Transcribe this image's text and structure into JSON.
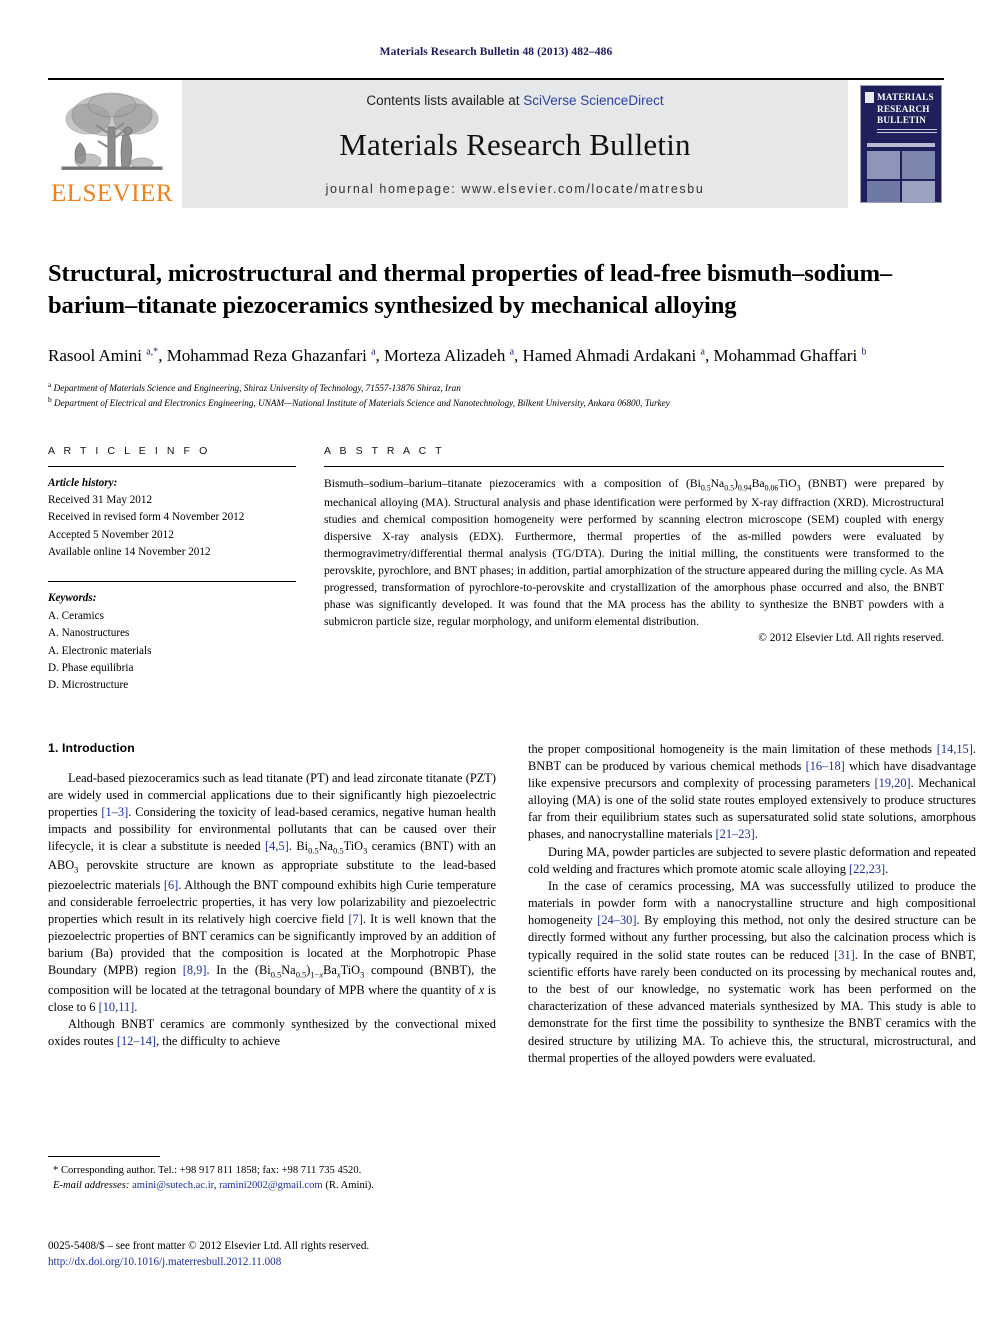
{
  "running_head": "Materials Research Bulletin 48 (2013) 482–486",
  "masthead": {
    "contents_prefix": "Contents lists available at ",
    "sciencedirect_link": "SciVerse ScienceDirect",
    "journal_title": "Materials Research Bulletin",
    "homepage": "journal homepage: www.elsevier.com/locate/matresbu",
    "publisher_wordmark": "ELSEVIER",
    "publisher_color": "#F08019",
    "link_color": "#2b42a8",
    "cover": {
      "line1": "MATERIALS",
      "line2": "RESEARCH",
      "line3": "BULLETIN",
      "background_color": "#1f1f5c"
    }
  },
  "article": {
    "title": "Structural, microstructural and thermal properties of lead-free bismuth–sodium–barium–titanate piezoceramics synthesized by mechanical alloying",
    "authors_html": "Rasool Amini <sup>a,*</sup>, Mohammad Reza Ghazanfari <sup>a</sup>, Morteza Alizadeh <sup>a</sup>, Hamed Ahmadi Ardakani <sup>a</sup>, Mohammad Ghaffari <sup>b</sup>",
    "affiliations": [
      {
        "marker": "a",
        "text": "Department of Materials Science and Engineering, Shiraz University of Technology, 71557-13876 Shiraz, Iran"
      },
      {
        "marker": "b",
        "text": "Department of Electrical and Electronics Engineering, UNAM—National Institute of Materials Science and Nanotechnology, Bilkent University, Ankara 06800, Turkey"
      }
    ]
  },
  "article_info": {
    "heading": "A R T I C L E   I N F O",
    "history_label": "Article history:",
    "history": [
      "Received 31 May 2012",
      "Received in revised form 4 November 2012",
      "Accepted 5 November 2012",
      "Available online 14 November 2012"
    ],
    "keywords_label": "Keywords:",
    "keywords": [
      "A. Ceramics",
      "A. Nanostructures",
      "A. Electronic materials",
      "D. Phase equilibria",
      "D. Microstructure"
    ]
  },
  "abstract": {
    "heading": "A B S T R A C T",
    "text_html": "Bismuth–sodium–barium–titanate piezoceramics with a composition of (Bi<sub>0.5</sub>Na<sub>0.5</sub>)<sub>0.94</sub>Ba<sub>0.06</sub>TiO<sub>3</sub> (BNBT) were prepared by mechanical alloying (MA). Structural analysis and phase identification were performed by X-ray diffraction (XRD). Microstructural studies and chemical composition homogeneity were performed by scanning electron microscope (SEM) coupled with energy dispersive X-ray analysis (EDX). Furthermore, thermal properties of the as-milled powders were evaluated by thermogravimetry/differential thermal analysis (TG/DTA). During the initial milling, the constituents were transformed to the perovskite, pyrochlore, and BNT phases; in addition, partial amorphization of the structure appeared during the milling cycle. As MA progressed, transformation of pyrochlore-to-perovskite and crystallization of the amorphous phase occurred and also, the BNBT phase was significantly developed. It was found that the MA process has the ability to synthesize the BNBT powders with a submicron particle size, regular morphology, and uniform elemental distribution.",
    "copyright": "© 2012 Elsevier Ltd. All rights reserved."
  },
  "body": {
    "section_heading": "1. Introduction",
    "left_paragraphs_html": [
      "Lead-based piezoceramics such as lead titanate (PT) and lead zirconate titanate (PZT) are widely used in commercial applications due to their significantly high piezoelectric properties <span class=\"ref\">[1–3]</span>. Considering the toxicity of lead-based ceramics, negative human health impacts and possibility for environmental pollutants that can be caused over their lifecycle, it is clear a substitute is needed <span class=\"ref\">[4,5]</span>. Bi<sub>0.5</sub>Na<sub>0.5</sub>TiO<sub>3</sub> ceramics (BNT) with an ABO<sub>3</sub> perovskite structure are known as appropriate substitute to the lead-based piezoelectric materials <span class=\"ref\">[6]</span>. Although the BNT compound exhibits high Curie temperature and considerable ferroelectric properties, it has very low polarizability and piezoelectric properties which result in its relatively high coercive field <span class=\"ref\">[7]</span>. It is well known that the piezoelectric properties of BNT ceramics can be significantly improved by an addition of barium (Ba) provided that the composition is located at the Morphotropic Phase Boundary (MPB) region <span class=\"ref\">[8,9]</span>. In the (Bi<sub>0.5</sub>Na<sub>0.5</sub>)<sub>1−<i>x</i></sub>Ba<sub><i>x</i></sub>TiO<sub>3</sub> compound (BNBT), the composition will be located at the tetragonal boundary of MPB where the quantity of <i>x</i> is close to 6 <span class=\"ref\">[10,11]</span>.",
      "Although BNBT ceramics are commonly synthesized by the convectional mixed oxides routes <span class=\"ref\">[12–14]</span>, the difficulty to achieve"
    ],
    "right_paragraphs_html": [
      "the proper compositional homogeneity is the main limitation of these methods <span class=\"ref\">[14,15]</span>. BNBT can be produced by various chemical methods <span class=\"ref\">[16–18]</span> which have disadvantage like expensive precursors and complexity of processing parameters <span class=\"ref\">[19,20]</span>. Mechanical alloying (MA) is one of the solid state routes employed extensively to produce structures far from their equilibrium states such as supersaturated solid state solutions, amorphous phases, and nanocrystalline materials <span class=\"ref\">[21–23]</span>.",
      "During MA, powder particles are subjected to severe plastic deformation and repeated cold welding and fractures which promote atomic scale alloying <span class=\"ref\">[22,23]</span>.",
      "In the case of ceramics processing, MA was successfully utilized to produce the materials in powder form with a nanocrystalline structure and high compositional homogeneity <span class=\"ref\">[24–30]</span>. By employing this method, not only the desired structure can be directly formed without any further processing, but also the calcination process which is typically required in the solid state routes can be reduced <span class=\"ref\">[31]</span>. In the case of BNBT, scientific efforts have rarely been conducted on its processing by mechanical routes and, to the best of our knowledge, no systematic work has been performed on the characterization of these advanced materials synthesized by MA. This study is able to demonstrate for the first time the possibility to synthesize the BNBT ceramics with the desired structure by utilizing MA. To achieve this, the structural, microstructural, and thermal properties of the alloyed powders were evaluated."
    ],
    "first_paragraph_indent_note": ""
  },
  "footnote": {
    "corresponding_html": "* Corresponding author. Tel.: +98 917 811 1858; fax: +98 711 735 4520.",
    "email_label": "E-mail addresses:",
    "email_1": "amini@sutech.ac.ir",
    "email_2": "ramini2002@gmail.com",
    "email_owner": "(R. Amini)."
  },
  "footer": {
    "issn_line": "0025-5408/$ – see front matter © 2012 Elsevier Ltd. All rights reserved.",
    "doi": "http://dx.doi.org/10.1016/j.materresbull.2012.11.008"
  }
}
